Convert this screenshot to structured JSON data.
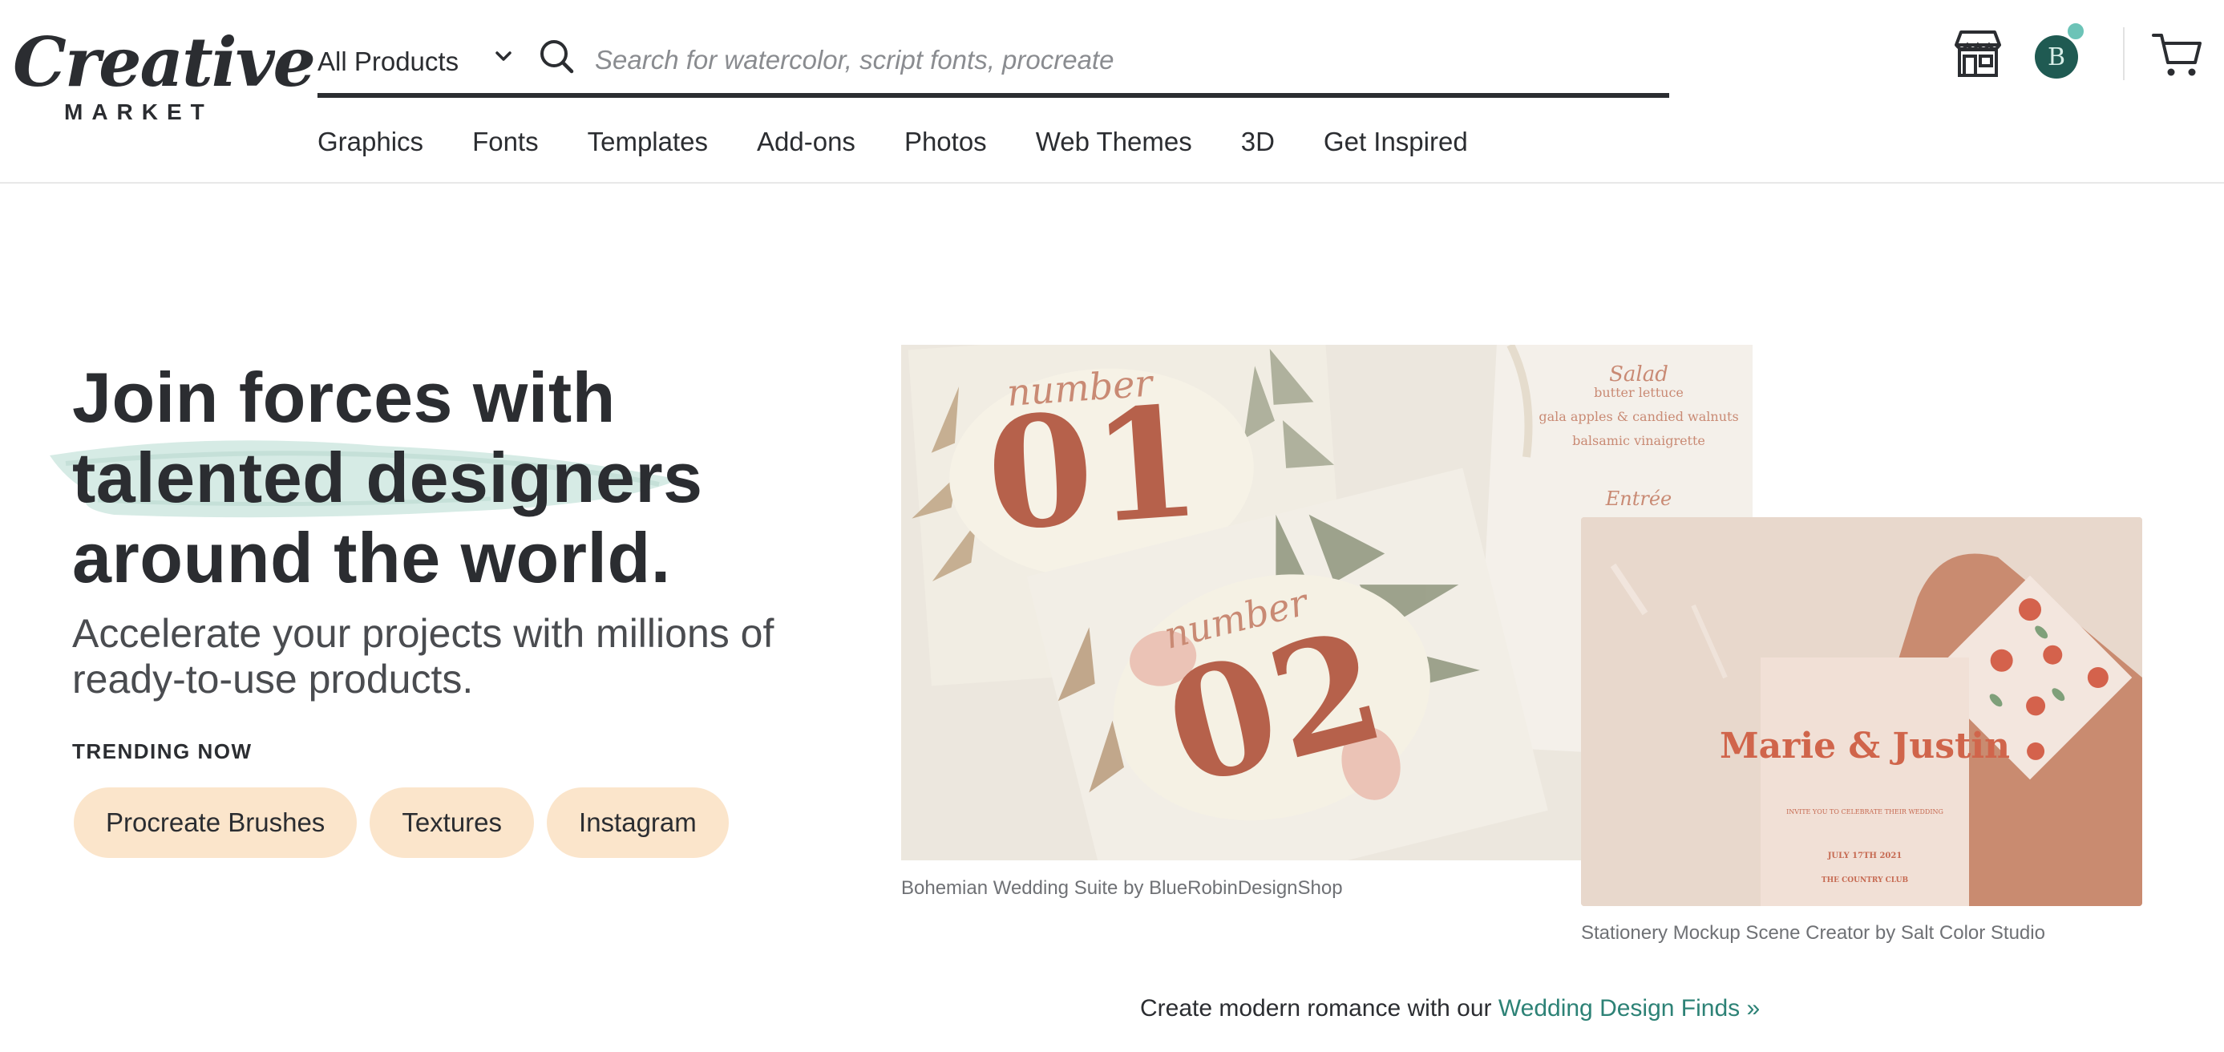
{
  "header": {
    "logo_script": "Creative",
    "logo_market": "MARKET",
    "product_select": "All Products",
    "search_placeholder": "Search for watercolor, script fonts, procreate",
    "avatar_initial": "B",
    "nav": [
      "Graphics",
      "Fonts",
      "Templates",
      "Add-ons",
      "Photos",
      "Web Themes",
      "3D",
      "Get Inspired"
    ]
  },
  "hero": {
    "title_lines": [
      "Join forces with",
      "talented designers",
      "around the world."
    ],
    "subtitle": "Accelerate your projects with millions of ready-to-use products.",
    "trending_label": "TRENDING NOW",
    "trending_chips": [
      "Procreate Brushes",
      "Textures",
      "Instagram"
    ]
  },
  "images": {
    "card1_number_word_1": "number",
    "card1_number_1": "01",
    "card1_number_word_2": "number",
    "card1_number_2": "02",
    "menu_lines": [
      "Salad",
      "butter lettuce",
      "gala apples & candied walnuts",
      "balsamic vinaigrette",
      "Entrée"
    ],
    "invite_names": "Marie & Justin",
    "invite_small": [
      "INVITE YOU TO CELEBRATE THEIR WEDDING",
      "JULY 17TH 2021",
      "THE COUNTRY CLUB"
    ],
    "caption1": "Bohemian Wedding Suite by BlueRobinDesignShop",
    "caption2": "Stationery Mockup Scene Creator by Salt Color Studio"
  },
  "promo": {
    "text": "Create modern romance with our ",
    "link": "Wedding Design Finds »"
  },
  "colors": {
    "accent_link": "#2d8276",
    "chip_bg": "#fbe5cb",
    "avatar_bg": "#1f5a52",
    "notification_dot": "#6cc3b7",
    "text_dark": "#2b2d31"
  },
  "icons": [
    "chevron-down-icon",
    "search-icon",
    "shop-icon",
    "avatar",
    "cart-icon"
  ]
}
